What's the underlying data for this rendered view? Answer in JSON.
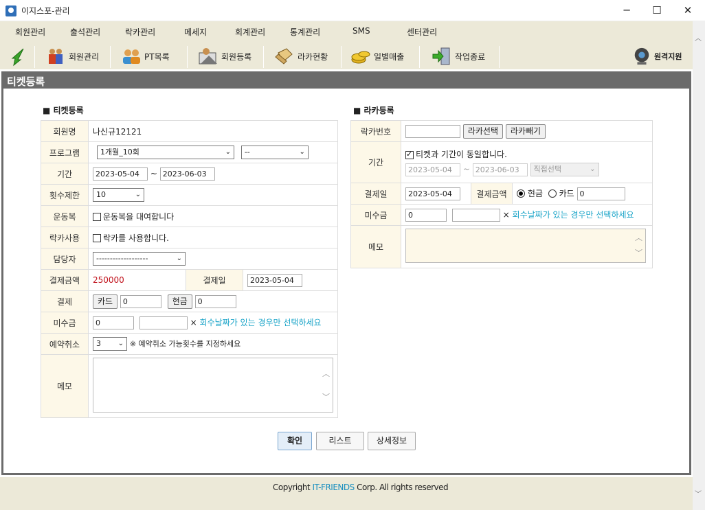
{
  "window": {
    "title": "이지스포-관리",
    "minimize": "─",
    "maximize": "☐",
    "close": "✕"
  },
  "menu": [
    "회원관리",
    "출석관리",
    "락카관리",
    "메세지",
    "회계관리",
    "통계관리",
    "SMS",
    "센터관리"
  ],
  "toolbar": {
    "back_icon": "green-arrow-icon",
    "items": [
      {
        "label": "회원관리",
        "icon": "members-icon"
      },
      {
        "label": "PT목록",
        "icon": "pt-list-icon"
      },
      {
        "label": "회원등록",
        "icon": "member-register-icon"
      },
      {
        "label": "라카현황",
        "icon": "locker-status-icon"
      },
      {
        "label": "일별매출",
        "icon": "daily-sales-icon"
      },
      {
        "label": "작업종료",
        "icon": "exit-icon"
      }
    ],
    "remote": "원격지원"
  },
  "panel": {
    "title": "티켓등록"
  },
  "ticket": {
    "heading": "■ 티켓등록",
    "labels": {
      "member": "회원명",
      "program": "프로그램",
      "period": "기간",
      "limit": "횟수제한",
      "uniform": "운동복",
      "locker": "락카사용",
      "manager": "담당자",
      "amount": "결제금액",
      "paydate": "결제일",
      "payment": "결제",
      "unpaid": "미수금",
      "cancel": "예약취소",
      "memo": "메모"
    },
    "member_name": "나신규12121",
    "program": "1개월_10회",
    "program2": "--",
    "start": "2023-05-04",
    "tilde": "~",
    "end": "2023-06-03",
    "limit": "10",
    "uniform_text": "운동복을 대여합니다",
    "locker_text": "락카를 사용합니다.",
    "manager": "-------------------",
    "amount": "250000",
    "paydate": "2023-05-04",
    "card_btn": "카드",
    "card_val": "0",
    "cash_btn": "현금",
    "cash_val": "0",
    "unpaid_val": "0",
    "unpaid_x": "×",
    "unpaid_note": "회수날짜가 있는 경우만 선택하세요",
    "cancel_val": "3",
    "cancel_note": "※ 예약취소 가능횟수를 지정하세요"
  },
  "locker": {
    "heading": "■ 라카등록",
    "labels": {
      "number": "락카번호",
      "period": "기간",
      "paydate": "결제일",
      "amount": "결제금액",
      "unpaid": "미수금",
      "memo": "메모"
    },
    "select_btn": "라카선택",
    "remove_btn": "라카빼기",
    "same_period": "티켓과 기간이 동일합니다.",
    "start": "2023-05-04",
    "tilde": "~",
    "end": "2023-06-03",
    "direct": "직접선택",
    "paydate": "2023-05-04",
    "cash": "현금",
    "card": "카드",
    "amount_val": "0",
    "unpaid_val": "0",
    "unpaid_x": "×",
    "unpaid_note": "회수날짜가 있는 경우만 선택하세요"
  },
  "actions": {
    "confirm": "확인",
    "list": "리스트",
    "detail": "상세정보"
  },
  "footer": {
    "copy_pre": "Copyright ",
    "copy_brand": "IT-FRIENDS",
    "copy_post": " Corp. All rights reserved"
  },
  "colors": {
    "amount": "#c0101a",
    "note": "#1aa4c8",
    "brand": "#1a8fc0"
  }
}
